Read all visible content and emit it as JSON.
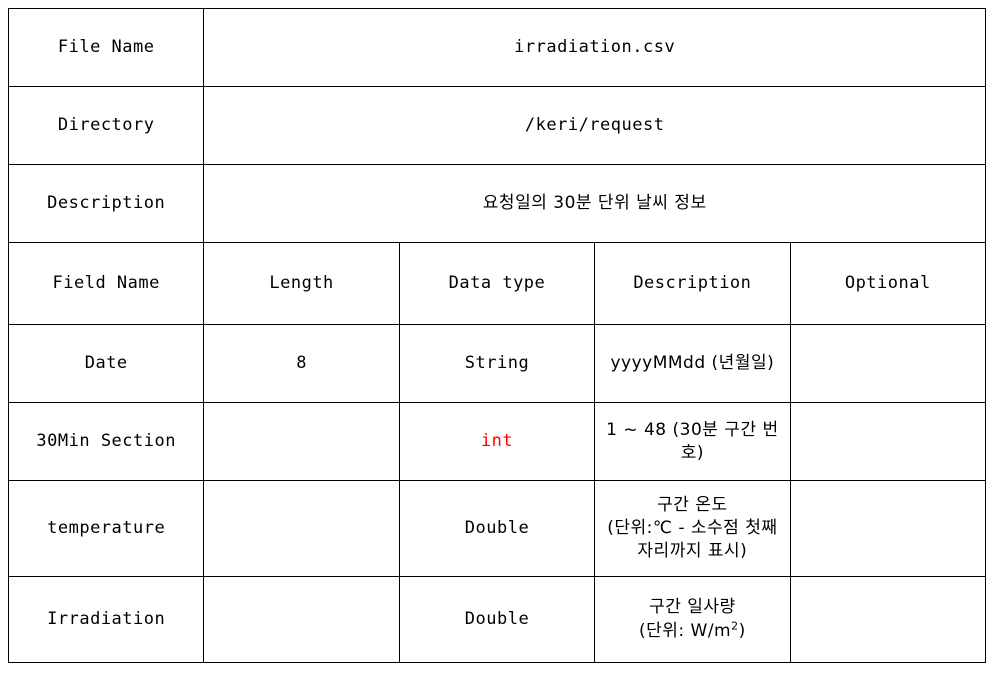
{
  "document": {
    "header_rows": [
      {
        "label": "File Name",
        "value": "irradiation.csv"
      },
      {
        "label": "Directory",
        "value": "/keri/request"
      },
      {
        "label": "Description",
        "value": "요청일의 30분 단위 날씨 정보"
      }
    ],
    "column_headers": [
      "Field Name",
      "Length",
      "Data type",
      "Description",
      "Optional"
    ],
    "rows": [
      {
        "field_name": "Date",
        "length": "8",
        "data_type": "String",
        "data_type_color": "#000000",
        "description_line1": "yyyyMMdd (년월일)",
        "description_line2": "",
        "description_line3": "",
        "optional": ""
      },
      {
        "field_name": "30Min Section",
        "length": "",
        "data_type": "int",
        "data_type_color": "#ff0000",
        "description_line1": "1 ~ 48 (30분 구간 번호)",
        "description_line2": "",
        "description_line3": "",
        "optional": ""
      },
      {
        "field_name": "temperature",
        "length": "",
        "data_type": "Double",
        "data_type_color": "#000000",
        "description_line1": "구간 온도",
        "description_line2": "(단위:℃ - 소수점 첫째",
        "description_line3": "자리까지 표시)",
        "optional": ""
      },
      {
        "field_name": "Irradiation",
        "length": "",
        "data_type": "Double",
        "data_type_color": "#000000",
        "description_line1": "구간 일사량",
        "description_line2": "(단위: W/m2)",
        "description_line3": "",
        "optional": ""
      }
    ]
  }
}
